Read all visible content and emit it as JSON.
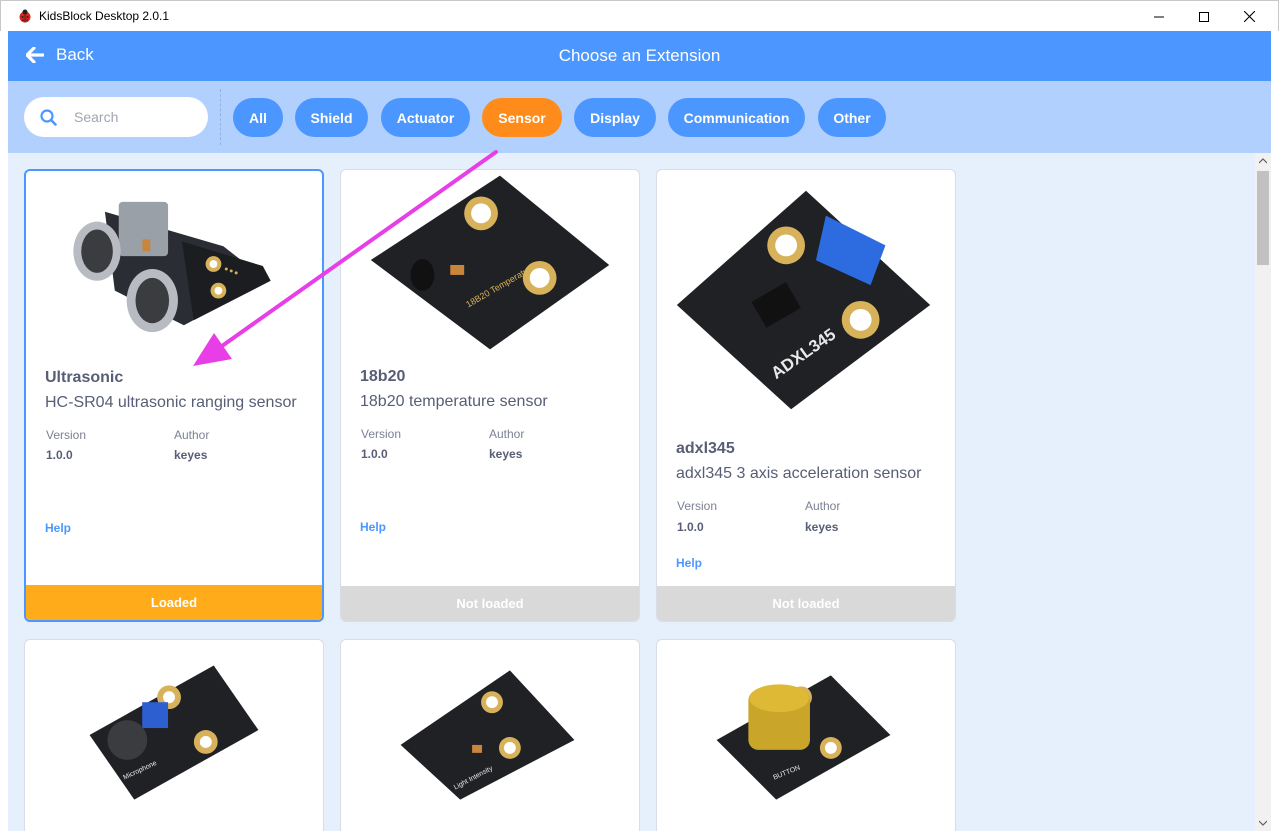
{
  "window": {
    "title": "KidsBlock Desktop 2.0.1"
  },
  "header": {
    "back_label": "Back",
    "title": "Choose an Extension"
  },
  "search": {
    "placeholder": "Search",
    "value": ""
  },
  "filters": [
    {
      "label": "All",
      "active": false
    },
    {
      "label": "Shield",
      "active": false
    },
    {
      "label": "Actuator",
      "active": false
    },
    {
      "label": "Sensor",
      "active": true
    },
    {
      "label": "Display",
      "active": false
    },
    {
      "label": "Communication",
      "active": false
    },
    {
      "label": "Other",
      "active": false
    }
  ],
  "meta_labels": {
    "version": "Version",
    "author": "Author",
    "help": "Help"
  },
  "cards": [
    {
      "name": "Ultrasonic",
      "description": "HC-SR04 ultrasonic ranging sensor",
      "version": "1.0.0",
      "author": "keyes",
      "status": "Loaded",
      "image": "ultrasonic-sensor-image"
    },
    {
      "name": "18b20",
      "description": "18b20 temperature sensor",
      "version": "1.0.0",
      "author": "keyes",
      "status": "Not loaded",
      "image": "temperature-sensor-image",
      "image_text": "18B20 Temperature"
    },
    {
      "name": "adxl345",
      "description": "adxl345 3 axis acceleration sensor",
      "version": "1.0.0",
      "author": "keyes",
      "status": "Not loaded",
      "image": "accelerometer-image",
      "image_text": "ADXL345"
    },
    {
      "name": "",
      "image": "microphone-sensor-image",
      "image_text": "Microphone"
    },
    {
      "name": "",
      "image": "light-sensor-image",
      "image_text": "Light Intensity"
    },
    {
      "name": "",
      "image": "button-module-image",
      "image_text": "BUTTON"
    }
  ],
  "colors": {
    "brand_blue": "#4c97ff",
    "active_orange": "#ff8c1a",
    "loaded": "#ffab1a",
    "annotation_arrow": "#e83ee8"
  }
}
